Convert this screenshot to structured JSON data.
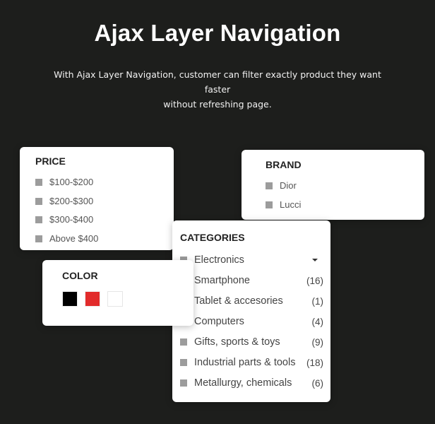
{
  "header": {
    "title": "Ajax Layer Navigation",
    "subtitle_line1": "With Ajax Layer Navigation, customer can filter exactly product they want faster",
    "subtitle_line2": "without refreshing page."
  },
  "price": {
    "title": "PRICE",
    "items": [
      "$100-$200",
      "$200-$300",
      "$300-$400",
      "Above $400"
    ]
  },
  "brand": {
    "title": "BRAND",
    "items": [
      "Dior",
      "Lucci"
    ]
  },
  "color": {
    "title": "COLOR",
    "swatches": [
      {
        "name": "black",
        "hex": "#000000"
      },
      {
        "name": "red",
        "hex": "#e22b2b"
      },
      {
        "name": "white",
        "hex": "#ffffff"
      }
    ]
  },
  "categories": {
    "title": "CATEGORIES",
    "items": [
      {
        "label": "Electronics",
        "count": "",
        "expandable": true
      },
      {
        "label": "Smartphone",
        "count": "(16)"
      },
      {
        "label": "Tablet & accesories",
        "count": "(1)"
      },
      {
        "label": "Computers",
        "count": "(4)"
      },
      {
        "label": "Gifts, sports & toys",
        "count": "(9)"
      },
      {
        "label": "Industrial parts & tools",
        "count": "(18)"
      },
      {
        "label": "Metallurgy, chemicals",
        "count": "(6)"
      }
    ]
  },
  "colors": {
    "background": "#1d1e1c",
    "checkbox": "#9c9c9c"
  }
}
